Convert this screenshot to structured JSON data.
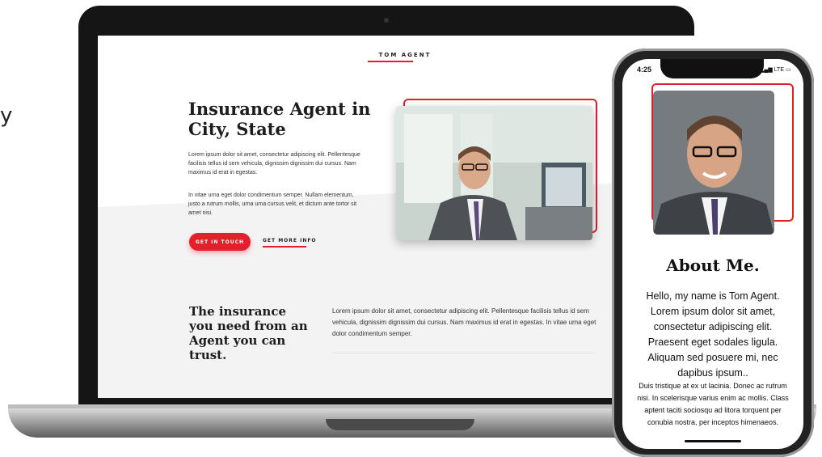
{
  "stray_glyph": "y",
  "site": {
    "brand": "TOM AGENT",
    "hero": {
      "title": "Insurance Agent in City, State",
      "paragraph1": "Lorem ipsum dolor sit amet, consectetur adipiscing elit. Pellentesque facilisis tellus id sem vehicula, dignissim dignissim dui cursus. Nam maximus id erat in egestas.",
      "paragraph2": "In vitae urna eget dolor condimentum semper. Nullam elementum, justo a rutrum mollis, urna uma cursus velit, et dictum ante tortor sit amet nisi.",
      "primary_button": "GET IN TOUCH",
      "secondary_button": "GET MORE INFO"
    },
    "section": {
      "title": "The insurance you need from an Agent you can trust.",
      "text": "Lorem ipsum dolor sit amet, consectetur adipiscing elit. Pellentesque facilisis tellus id sem vehicula, dignissim dignissim dui cursus. Nam maximus id erat in egestas. In vitae urna eget dolor condimentum semper."
    }
  },
  "phone": {
    "time": "4:25",
    "status": "LTE",
    "about_title": "About Me.",
    "about_p1": "Hello, my name is Tom Agent. Lorem ipsum dolor sit amet, consectetur adipiscing elit. Praesent eget sodales ligula. Aliquam sed posuere mi, nec dapibus ipsum..",
    "about_p2": "Duis tristique at ex ut lacinia. Donec ac rutrum nisi. In scelerisque varius enim ac mollis. Class aptent taciti sociosqu ad litora torquent per conubia nostra, per inceptos himenaeos."
  },
  "colors": {
    "accent": "#e0202a",
    "text": "#1d1d1d",
    "device": "#151515"
  }
}
